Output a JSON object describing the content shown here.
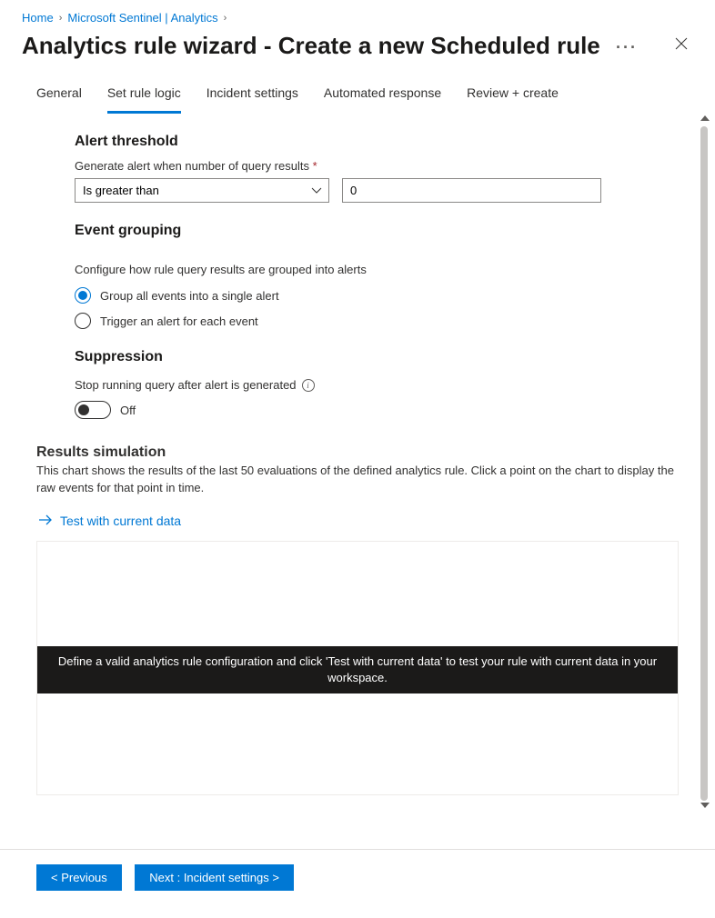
{
  "breadcrumb": {
    "home": "Home",
    "second": "Microsoft Sentinel | Analytics"
  },
  "page": {
    "title": "Analytics rule wizard - Create a new Scheduled rule"
  },
  "tabs": {
    "general": "General",
    "setRuleLogic": "Set rule logic",
    "incidentSettings": "Incident settings",
    "automatedResponse": "Automated response",
    "reviewCreate": "Review + create"
  },
  "alertThreshold": {
    "heading": "Alert threshold",
    "label": "Generate alert when number of query results",
    "operator": "Is greater than",
    "value": "0"
  },
  "eventGrouping": {
    "heading": "Event grouping",
    "desc": "Configure how rule query results are grouped into alerts",
    "opt1": "Group all events into a single alert",
    "opt2": "Trigger an alert for each event"
  },
  "suppression": {
    "heading": "Suppression",
    "label": "Stop running query after alert is generated",
    "toggle": "Off"
  },
  "results": {
    "heading": "Results simulation",
    "desc": "This chart shows the results of the last 50 evaluations of the defined analytics rule. Click a point on the chart to display the raw events for that point in time.",
    "testLink": "Test with current data",
    "overlay": "Define a valid analytics rule configuration and click 'Test with current data' to test your rule with current data in your workspace."
  },
  "footer": {
    "previous": "< Previous",
    "next": "Next : Incident settings >"
  }
}
